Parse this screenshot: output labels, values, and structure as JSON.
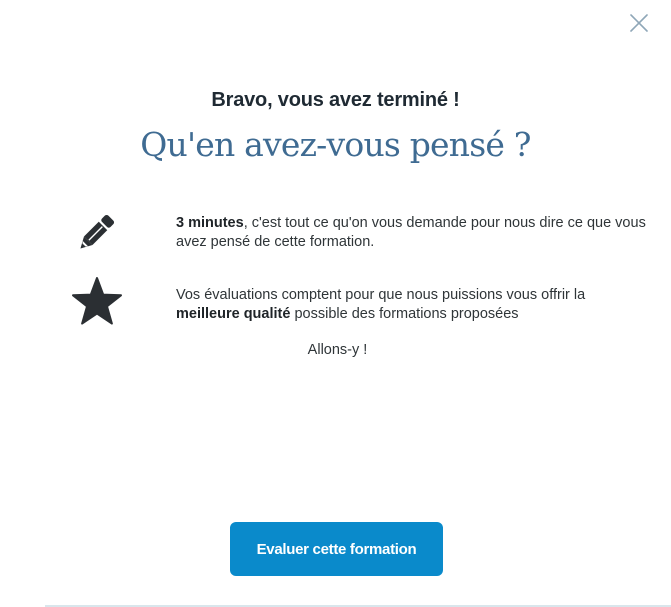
{
  "modal": {
    "close_icon": "close-icon",
    "headline": "Bravo, vous avez terminé !",
    "question": "Qu'en avez-vous pensé ?",
    "features": [
      {
        "icon": "pencil-icon",
        "bold": "3 minutes",
        "text_after": ", c'est tout ce qu'on vous demande pour nous dire ce que vous avez pensé de cette formation."
      },
      {
        "icon": "star-icon",
        "text_before": "Vos évaluations comptent pour que nous puissions vous offrir la ",
        "bold": "meilleure qualité",
        "text_after": " possible des formations proposées"
      }
    ],
    "cta_text": "Allons-y !",
    "button_label": "Evaluer cette formation"
  },
  "colors": {
    "headline": "#1f2a33",
    "question": "#3f6b92",
    "icon": "#2b2f33",
    "button_bg": "#0a8acb",
    "button_text": "#ffffff",
    "close_icon": "#8fa7b8"
  }
}
